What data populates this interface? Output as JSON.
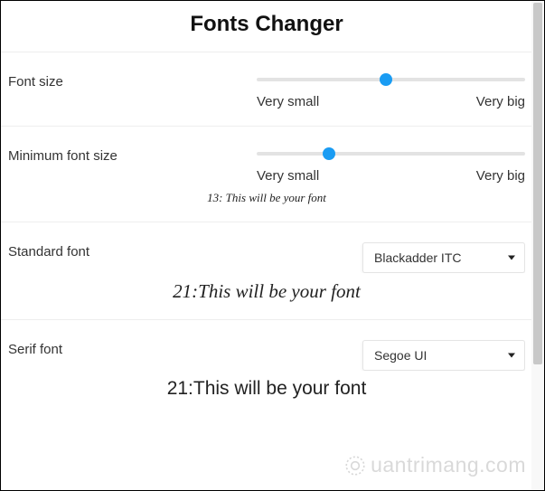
{
  "title": "Fonts Changer",
  "sections": {
    "fontSize": {
      "label": "Font size",
      "minLabel": "Very small",
      "maxLabel": "Very big",
      "thumbPercent": 48
    },
    "minFontSize": {
      "label": "Minimum font size",
      "minLabel": "Very small",
      "maxLabel": "Very big",
      "thumbPercent": 27,
      "preview": "13: This will be your font"
    },
    "standardFont": {
      "label": "Standard font",
      "value": "Blackadder ITC",
      "preview": "21:This will be your font"
    },
    "serifFont": {
      "label": "Serif font",
      "value": "Segoe UI",
      "preview": "21:This will be your font"
    }
  },
  "watermark": "uantrimang.com"
}
